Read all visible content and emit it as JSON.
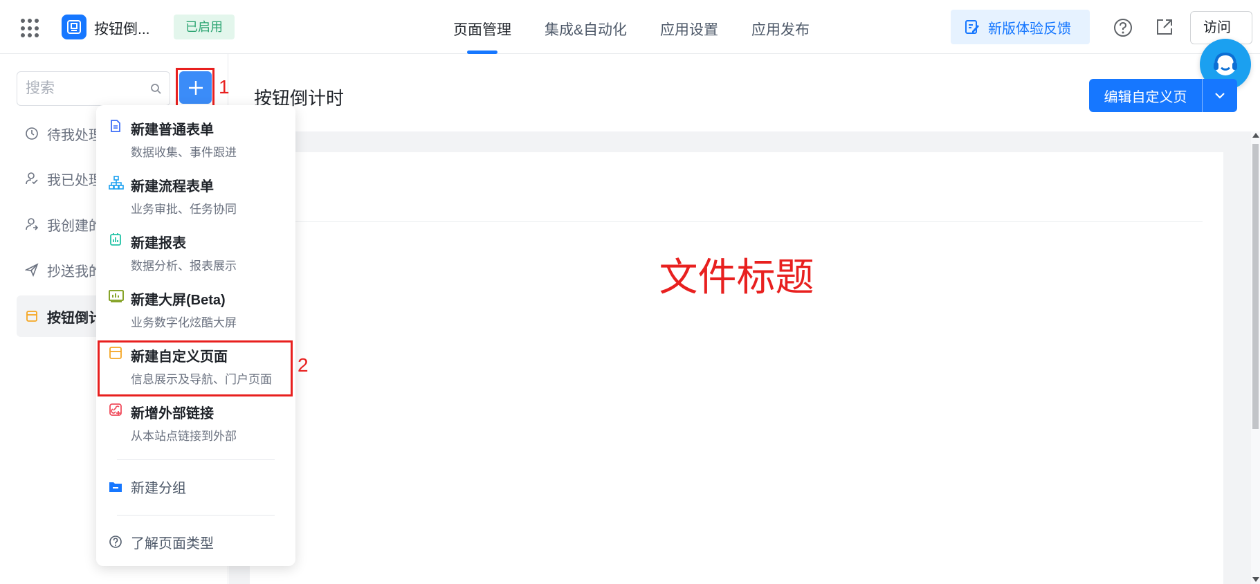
{
  "header": {
    "app_name": "按钮倒...",
    "status": "已启用",
    "nav": [
      "页面管理",
      "集成&自动化",
      "应用设置",
      "应用发布"
    ],
    "feedback_label": "新版体验反馈",
    "visit_label": "访问"
  },
  "sidebar": {
    "search_placeholder": "搜索",
    "annotation_1": "1",
    "items": [
      {
        "label": "待我处理"
      },
      {
        "label": "我已处理"
      },
      {
        "label": "我创建的"
      },
      {
        "label": "抄送我的"
      },
      {
        "label": "按钮倒计时"
      }
    ]
  },
  "dropdown": {
    "items": [
      {
        "title": "新建普通表单",
        "desc": "数据收集、事件跟进"
      },
      {
        "title": "新建流程表单",
        "desc": "业务审批、任务协同"
      },
      {
        "title": "新建报表",
        "desc": "数据分析、报表展示"
      },
      {
        "title": "新建大屏(Beta)",
        "desc": "业务数字化炫酷大屏"
      },
      {
        "title": "新建自定义页面",
        "desc": "信息展示及导航、门户页面"
      },
      {
        "title": "新增外部链接",
        "desc": "从本站点链接到外部"
      }
    ],
    "new_group": "新建分组",
    "learn_types": "了解页面类型",
    "annotation_2": "2"
  },
  "main": {
    "page_title": "按钮倒计时",
    "edit_label": "编辑自定义页",
    "doc_title": "文件标题"
  },
  "colors": {
    "primary": "#1677ff",
    "annotation_red": "#e8201f",
    "status_green": "#2ba471"
  }
}
